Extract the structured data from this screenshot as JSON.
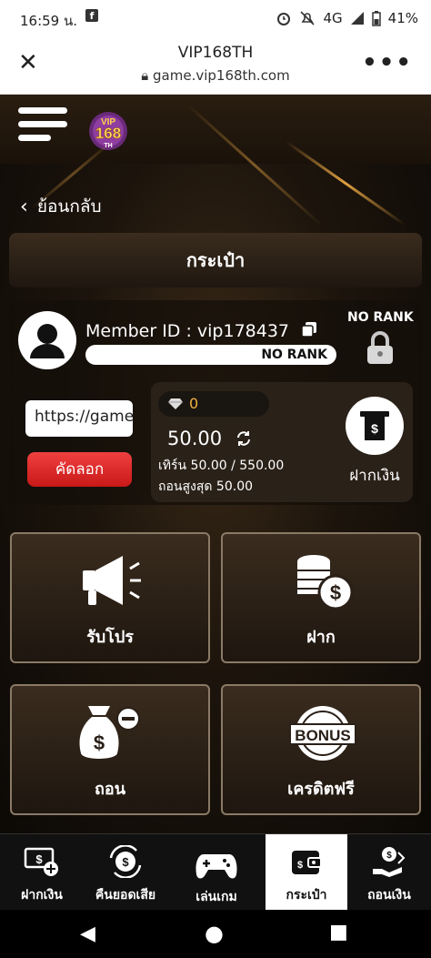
{
  "status_bar": {
    "time": "16:59 น.",
    "fb": "f",
    "network": "4G",
    "battery": "41%"
  },
  "browser": {
    "close": "✕",
    "title": "VIP168TH",
    "url": "game.vip168th.com",
    "more": "•••"
  },
  "header": {
    "logo_text": "VIP",
    "logo_num": "168",
    "logo_sub": "TH"
  },
  "back": {
    "label": "ย้อนกลับ"
  },
  "wallet_title": "กระเป๋า",
  "member": {
    "id_label": "Member ID : vip178437",
    "rank_bar": "NO RANK",
    "rank_top": "NO RANK",
    "link_value": "https://game",
    "copy_label": "คัดลอก"
  },
  "balance": {
    "diamond": "0",
    "amount": "50.00",
    "turnover": "เทิร์น 50.00 / 550.00",
    "max_withdraw": "ถอนสูงสุด 50.00",
    "deposit_label": "ฝากเงิน"
  },
  "tiles": [
    {
      "label": "รับโปร",
      "icon": "megaphone-icon"
    },
    {
      "label": "ฝาก",
      "icon": "coins-icon"
    },
    {
      "label": "ถอน",
      "icon": "money-bag-icon"
    },
    {
      "label": "เครดิตฟรี",
      "icon": "bonus-icon",
      "badge": "BONUS"
    }
  ],
  "bottom_nav": [
    {
      "label": "ฝากเงิน",
      "icon": "deposit-icon"
    },
    {
      "label": "คืนยอดเสีย",
      "icon": "refund-icon"
    },
    {
      "label": "เล่นเกม",
      "icon": "gamepad-icon"
    },
    {
      "label": "กระเป๋า",
      "icon": "wallet-icon",
      "active": true
    },
    {
      "label": "ถอนเงิน",
      "icon": "withdraw-icon"
    }
  ],
  "system_nav": {
    "back": "◀",
    "home": "●",
    "recent": "■"
  }
}
